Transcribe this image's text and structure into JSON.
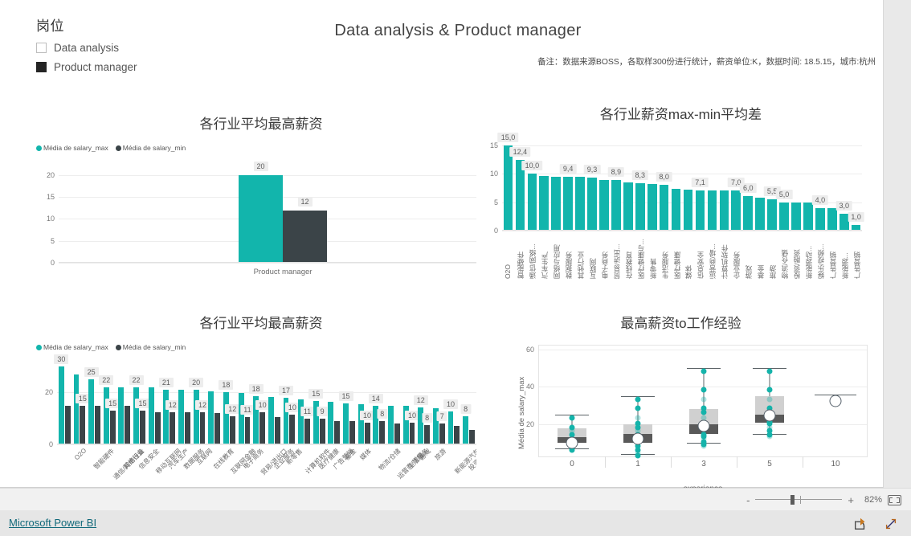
{
  "report": {
    "title": "Data analysis & Product manager",
    "note": "备注：数据来源BOSS，各取样300份进行统计，薪资单位:K，数据时间: 18.5.15，城市:杭州",
    "accent_color": "#12b5ac",
    "dark_color": "#3b4448"
  },
  "slicer": {
    "title": "岗位",
    "items": [
      {
        "label": "Data analysis",
        "checked": false
      },
      {
        "label": "Product manager",
        "checked": true
      }
    ]
  },
  "legend": {
    "max_label": "Média de salary_max",
    "min_label": "Média de salary_min"
  },
  "statusbar": {
    "minus": "-",
    "plus": "+",
    "zoom_level": "82%",
    "fit_icon": "fit-to-page-icon"
  },
  "footer": {
    "brand": "Microsoft Power BI",
    "share_icon": "share-icon",
    "fullscreen_icon": "fullscreen-icon"
  },
  "chart_data": [
    {
      "id": "selected_role_avg",
      "type": "bar",
      "title": "各行业平均最高薪资",
      "categories": [
        "Product manager"
      ],
      "series": [
        {
          "name": "Média de salary_max",
          "color": "#12b5ac",
          "values": [
            20
          ]
        },
        {
          "name": "Média de salary_min",
          "color": "#3b4448",
          "values": [
            12
          ]
        }
      ],
      "labels": [
        [
          "20"
        ],
        [
          "12"
        ]
      ],
      "xlabel": "",
      "ylabel": "",
      "yticks": [
        0,
        5,
        10,
        15,
        20
      ],
      "ylim": [
        0,
        22
      ],
      "grid": true,
      "legend_position": "top-left"
    },
    {
      "id": "industry_maxmin_gap",
      "type": "bar",
      "title": "各行业薪资max-min平均差",
      "categories": [
        "O2O",
        "智能硬件",
        "通信/网络...",
        "汽车生产",
        "网络与应用",
        "数据服务",
        "其他行业",
        "互联网",
        "电子商务",
        "贸易/进出...",
        "在线教育",
        "医疗健康与...",
        "新零售",
        "生活服务",
        "医疗健康",
        "媒体",
        "信息安全",
        "运营商/增...",
        "计算机软件",
        "企业服务",
        "游戏",
        "基金",
        "旅游",
        "物流/仓储",
        "投资/融资",
        "新能源动...",
        "娱乐/视频...",
        "广告营销"
      ],
      "values": [
        15.0,
        12.4,
        10.0,
        9.6,
        9.5,
        9.5,
        9.4,
        9.3,
        8.9,
        8.9,
        8.4,
        8.3,
        8.2,
        8.0,
        7.3,
        7.2,
        7.1,
        7.1,
        7.1,
        7.0,
        6.0,
        5.8,
        5.5,
        5.0,
        5.0,
        5.0,
        4.0,
        4.0
      ],
      "labels": [
        "15,0",
        "12,4",
        "10,0",
        "",
        "",
        "9,4",
        "",
        "9,3",
        "",
        "8,9",
        "",
        "8,3",
        "",
        "8,0",
        "",
        "",
        "7,1",
        "",
        "",
        "7,0",
        "6,0",
        "",
        "5,5",
        "5,0",
        "",
        "",
        "4,0",
        ""
      ],
      "extra_bars": {
        "values": [
          3.0,
          1.0
        ],
        "labels": [
          "3,0",
          "1,0"
        ]
      },
      "xlabel": "",
      "ylabel": "",
      "yticks": [
        0,
        5,
        10,
        15
      ],
      "ylim": [
        0,
        15.8
      ],
      "grid": true,
      "legend_position": "none"
    },
    {
      "id": "industry_avg_salary",
      "type": "bar",
      "title": "各行业平均最高薪资",
      "categories": [
        "O2O",
        "智能硬件",
        "通信/网络设备",
        "其他行业",
        "信息安全",
        "移动互联网",
        "汽车生产",
        "数据服务",
        "互联网",
        "在线教育",
        "互联网金融",
        "电子商务",
        "贸易/进出口",
        "企业服务",
        "新零售",
        "计算机软件",
        "医疗健康",
        "广告营销",
        "基金",
        "媒体",
        "物流/仓储",
        "运营商/增值...",
        "生活服务",
        "游戏",
        "旅游",
        "新能源汽车",
        "投资/融资",
        "娱乐/视频..."
      ],
      "series": [
        {
          "name": "Média de salary_max",
          "color": "#12b5ac",
          "values": [
            30,
            27,
            25,
            22,
            22,
            22,
            22,
            21,
            21,
            21,
            20.5,
            20,
            19.8,
            18.5,
            18.3,
            18,
            17.3,
            16.8,
            16.3,
            15.8,
            15.5,
            15,
            15,
            14.8,
            14.3,
            13.8,
            12.8,
            11
          ]
        },
        {
          "name": "Média de salary_min",
          "color": "#3b4448",
          "values": [
            15,
            15,
            15,
            13,
            15,
            13,
            12.5,
            12.5,
            12.5,
            12.5,
            12,
            11,
            10.5,
            12.5,
            10.5,
            11.5,
            10,
            10,
            9,
            9,
            8.5,
            9,
            8,
            8.5,
            7.5,
            8,
            7,
            5.5
          ]
        }
      ],
      "labels_max": [
        "30",
        "",
        "25",
        "22",
        "",
        "22",
        "",
        "21",
        "",
        "20",
        "",
        "18",
        "",
        "18",
        "",
        "17",
        "",
        "15",
        "",
        "15",
        "",
        "14",
        "",
        "",
        "12",
        "",
        "10",
        "8"
      ],
      "labels_min": [
        "",
        "15",
        "",
        "15",
        "",
        "15",
        "",
        "12",
        "",
        "12",
        "",
        "12",
        "11",
        "10",
        "",
        "10",
        "11",
        "9",
        "",
        "",
        "10",
        "8",
        "",
        "10",
        "8",
        "7",
        "",
        ""
      ],
      "xlabel": "",
      "ylabel": "",
      "yticks": [
        0,
        20
      ],
      "ylim": [
        0,
        31
      ],
      "grid": true,
      "legend_position": "top-left"
    },
    {
      "id": "salary_to_experience",
      "type": "box",
      "title": "最高薪资to工作经验",
      "xlabel": "experience",
      "ylabel": "Média de salary_max",
      "categories": [
        "0",
        "1",
        "3",
        "5",
        "10"
      ],
      "yticks": [
        20,
        40,
        60
      ],
      "ylim": [
        2,
        62
      ],
      "grid": true,
      "boxes": [
        {
          "category": "0",
          "min": 7,
          "q1": 10,
          "median": 13,
          "q3": 18,
          "max": 25,
          "mean": 14.0,
          "points": [
            25,
            20,
            18,
            16,
            14,
            13,
            12,
            11,
            10,
            9,
            8
          ]
        },
        {
          "category": "1",
          "min": 4,
          "q1": 10,
          "median": 15,
          "q3": 20,
          "max": 35,
          "mean": 16.0,
          "points": [
            35,
            30,
            25,
            22,
            20,
            18,
            16,
            14,
            12,
            10,
            8,
            6,
            5
          ]
        },
        {
          "category": "3",
          "min": 10,
          "q1": 15,
          "median": 20,
          "q3": 28,
          "max": 50,
          "mean": 23.0,
          "points": [
            50,
            40,
            35,
            30,
            28,
            25,
            22,
            20,
            18,
            16,
            15,
            14,
            12,
            11,
            10
          ]
        },
        {
          "category": "5",
          "min": 15,
          "q1": 21,
          "median": 25,
          "q3": 35,
          "max": 50,
          "mean": 28.5,
          "points": [
            50,
            40,
            35,
            30,
            28,
            25,
            23,
            22,
            20,
            18,
            16,
            15
          ]
        },
        {
          "category": "10",
          "min": 36,
          "q1": 36,
          "median": 36,
          "q3": 36,
          "max": 36,
          "mean": 36.0,
          "points": []
        }
      ]
    }
  ]
}
